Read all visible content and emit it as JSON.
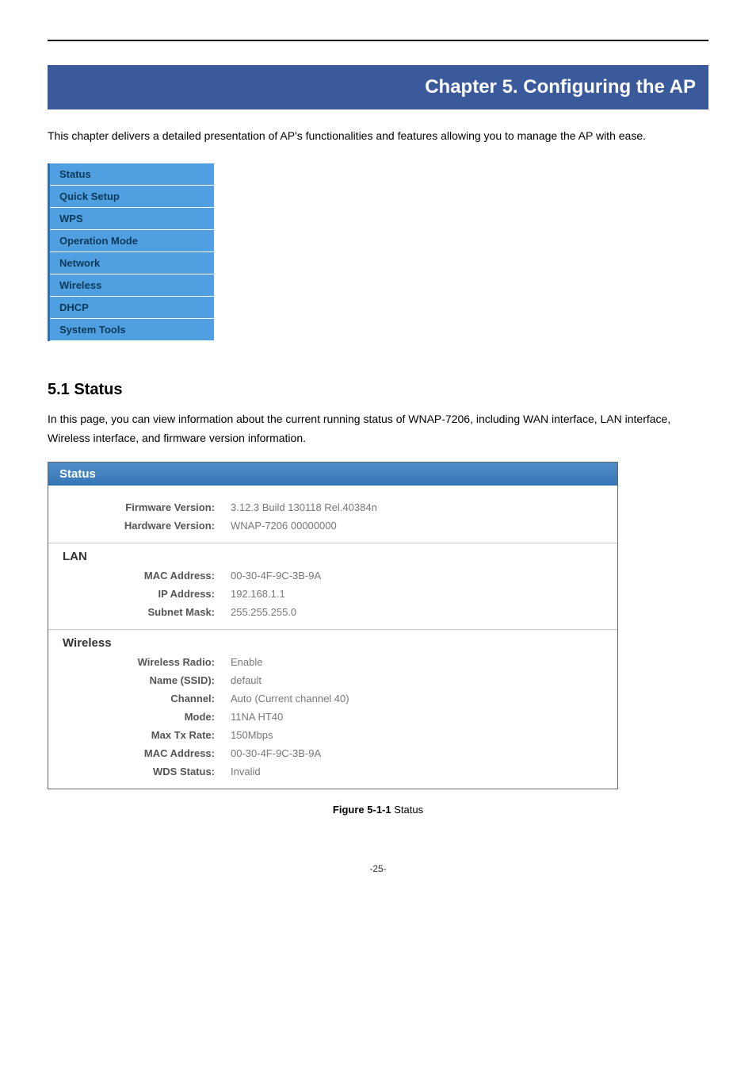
{
  "chapter": {
    "title": "Chapter 5.   Configuring the AP"
  },
  "intro": "This chapter delivers a detailed presentation of AP's functionalities and features allowing you to manage the AP with ease.",
  "nav": {
    "items": [
      "Status",
      "Quick Setup",
      "WPS",
      "Operation Mode",
      "Network",
      "Wireless",
      "DHCP",
      "System Tools"
    ]
  },
  "section": {
    "heading": "5.1  Status",
    "text": "In this page, you can view information about the current running status of WNAP-7206, including WAN interface, LAN interface, Wireless interface, and firmware version information."
  },
  "status": {
    "header": "Status",
    "top": {
      "firmware_label": "Firmware Version:",
      "firmware_value": "3.12.3 Build 130118 Rel.40384n",
      "hardware_label": "Hardware Version:",
      "hardware_value": "WNAP-7206 00000000"
    },
    "lan": {
      "heading": "LAN",
      "mac_label": "MAC Address:",
      "mac_value": "00-30-4F-9C-3B-9A",
      "ip_label": "IP Address:",
      "ip_value": "192.168.1.1",
      "subnet_label": "Subnet Mask:",
      "subnet_value": "255.255.255.0"
    },
    "wireless": {
      "heading": "Wireless",
      "radio_label": "Wireless Radio:",
      "radio_value": "Enable",
      "ssid_label": "Name (SSID):",
      "ssid_value": "default",
      "channel_label": "Channel:",
      "channel_value": "Auto (Current channel 40)",
      "mode_label": "Mode:",
      "mode_value": "11NA HT40",
      "rate_label": "Max Tx Rate:",
      "rate_value": "150Mbps",
      "wmac_label": "MAC Address:",
      "wmac_value": "00-30-4F-9C-3B-9A",
      "wds_label": "WDS Status:",
      "wds_value": "Invalid"
    }
  },
  "figure": {
    "label": "Figure 5-1-1",
    "name": " Status"
  },
  "page_number": "-25-"
}
